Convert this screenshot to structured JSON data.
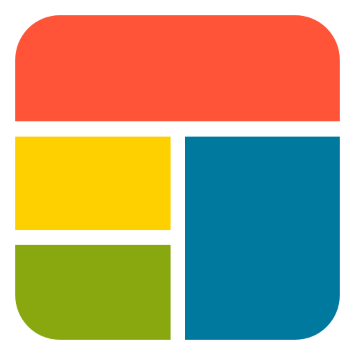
{
  "app_icon": {
    "icon_name": "collage-layout-icon",
    "colors": {
      "top_panel": "#FF5438",
      "left_top_panel": "#FFD000",
      "left_bottom_panel": "#89A80F",
      "right_panel": "#00799F",
      "gaps": "#FFFFFF"
    }
  }
}
